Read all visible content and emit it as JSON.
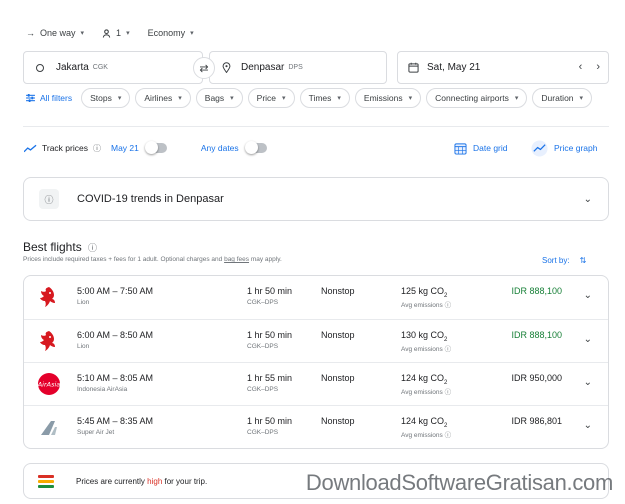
{
  "trip": {
    "type": "One way",
    "passengers": "1",
    "cabin": "Economy"
  },
  "search": {
    "from_city": "Jakarta",
    "from_code": "CGK",
    "to_city": "Denpasar",
    "to_code": "DPS",
    "date": "Sat, May 21"
  },
  "filters": {
    "all_label": "All filters",
    "chips": [
      "Stops",
      "Airlines",
      "Bags",
      "Price",
      "Times",
      "Emissions",
      "Connecting airports",
      "Duration"
    ]
  },
  "track": {
    "label": "Track prices",
    "date": "May 21",
    "any_dates": "Any dates",
    "date_grid": "Date grid",
    "price_graph": "Price graph"
  },
  "covid": {
    "title": "COVID-19 trends in Denpasar"
  },
  "best": {
    "title": "Best flights",
    "note_pre": "Prices include required taxes + fees for 1 adult. Optional charges and ",
    "note_link": "bag fees",
    "note_post": " may apply.",
    "sort_label": "Sort by:"
  },
  "flights": [
    {
      "times": "5:00 AM – 7:50 AM",
      "airline": "Lion",
      "duration": "1 hr 50 min",
      "route": "CGK–DPS",
      "stops": "Nonstop",
      "co2": "125 kg CO",
      "avg": "Avg emissions",
      "price": "IDR 888,100",
      "price_color": "#188038",
      "logo": "lion-air-logo"
    },
    {
      "times": "6:00 AM – 8:50 AM",
      "airline": "Lion",
      "duration": "1 hr 50 min",
      "route": "CGK–DPS",
      "stops": "Nonstop",
      "co2": "130 kg CO",
      "avg": "Avg emissions",
      "price": "IDR 888,100",
      "price_color": "#188038",
      "logo": "lion-air-logo"
    },
    {
      "times": "5:10 AM – 8:05 AM",
      "airline": "Indonesia AirAsia",
      "duration": "1 hr 55 min",
      "route": "CGK–DPS",
      "stops": "Nonstop",
      "co2": "124 kg CO",
      "avg": "Avg emissions",
      "price": "IDR 950,000",
      "price_color": "#202124",
      "logo": "airasia-logo"
    },
    {
      "times": "5:45 AM – 8:35 AM",
      "airline": "Super Air Jet",
      "duration": "1 hr 50 min",
      "route": "CGK–DPS",
      "stops": "Nonstop",
      "co2": "124 kg CO",
      "avg": "Avg emissions",
      "price": "IDR 986,801",
      "price_color": "#202124",
      "logo": "super-air-jet-logo"
    }
  ],
  "prices_status": {
    "pre": "Prices are currently ",
    "level": "high",
    "post": " for your trip."
  },
  "watermark": "DownloadSoftwareGratisan.com",
  "colors": {
    "accent": "#1a73e8",
    "green_price": "#188038",
    "high": "#d93025"
  }
}
